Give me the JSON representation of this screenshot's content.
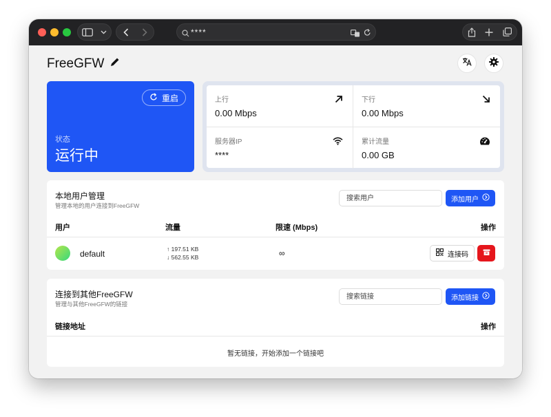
{
  "browser": {
    "url": "****"
  },
  "header": {
    "title": "FreeGFW"
  },
  "status_card": {
    "restart_label": "重启",
    "status_label": "状态",
    "status_value": "运行中"
  },
  "stats": [
    {
      "label": "上行",
      "value": "0.00 Mbps",
      "icon": "arrow-up-right-icon"
    },
    {
      "label": "下行",
      "value": "0.00 Mbps",
      "icon": "arrow-down-right-icon"
    },
    {
      "label": "服务器IP",
      "value": "****",
      "icon": "wifi-icon"
    },
    {
      "label": "累计流量",
      "value": "0.00 GB",
      "icon": "gauge-icon"
    }
  ],
  "users_section": {
    "title": "本地用户管理",
    "subtitle": "管理本地的用户连接到FreeGFW",
    "search_placeholder": "搜索用户",
    "add_label": "添加用户",
    "columns": [
      "用户",
      "流量",
      "限速 (Mbps)",
      "操作"
    ],
    "rows": [
      {
        "name": "default",
        "upload": "↑ 197.51 KB",
        "download": "↓ 562.55 KB",
        "limit": "∞",
        "connect_label": "连接码"
      }
    ]
  },
  "links_section": {
    "title": "连接到其他FreeGFW",
    "subtitle": "管理与其他FreeGFW的链接",
    "search_placeholder": "搜索链接",
    "add_label": "添加链接",
    "columns": [
      "链接地址",
      "操作"
    ],
    "empty_text": "暂无链接，开始添加一个链接吧"
  }
}
